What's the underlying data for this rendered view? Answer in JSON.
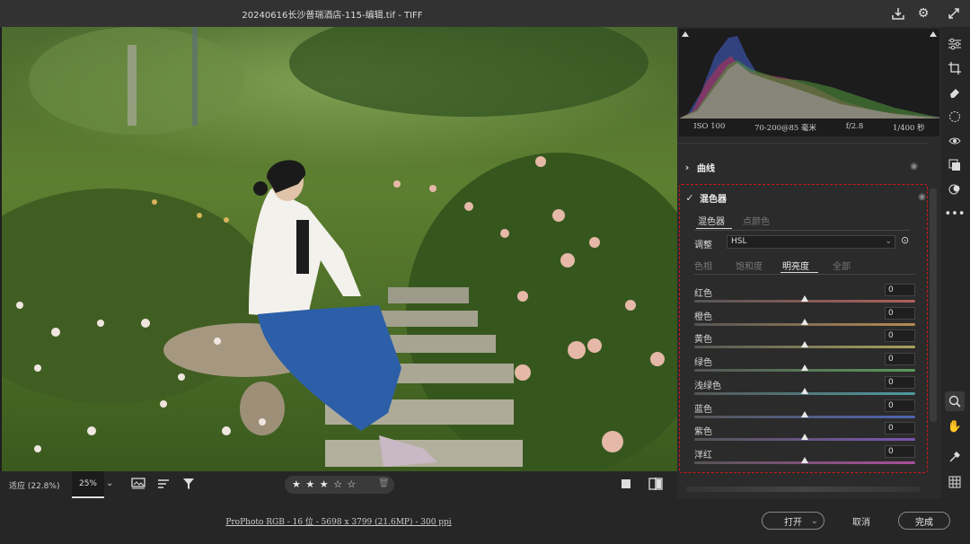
{
  "window": {
    "title": "20240616长沙普瑞酒店-115-编辑.tif -  TIFF"
  },
  "histogram": {
    "iso": "ISO 100",
    "lens": "70-200@85 毫米",
    "aperture": "f/2.8",
    "shutter": "1/400 秒"
  },
  "panels": {
    "curve_label": "曲线",
    "mixer_label": "混色器"
  },
  "mixer": {
    "tabs": [
      "混色器",
      "点颜色"
    ],
    "adjust_label": "调整",
    "adjust_value": "HSL",
    "subtabs": [
      "色相",
      "饱和度",
      "明亮度",
      "全部"
    ],
    "active_subtab": 2,
    "sliders": [
      {
        "label": "红色",
        "value": "0",
        "track_color": "#b0605a"
      },
      {
        "label": "橙色",
        "value": "0",
        "track_color": "#b58a52"
      },
      {
        "label": "黄色",
        "value": "0",
        "track_color": "#a8a35a"
      },
      {
        "label": "绿色",
        "value": "0",
        "track_color": "#5a9a5a"
      },
      {
        "label": "浅绿色",
        "value": "0",
        "track_color": "#4e9aa0"
      },
      {
        "label": "蓝色",
        "value": "0",
        "track_color": "#4e63b0"
      },
      {
        "label": "紫色",
        "value": "0",
        "track_color": "#7a55b0"
      },
      {
        "label": "洋红",
        "value": "0",
        "track_color": "#aa4e9c"
      }
    ]
  },
  "bottombar": {
    "fit_label": "适应 (22.8%)",
    "zoom_value": "25%",
    "rating": "★ ★ ★ ☆ ☆"
  },
  "statusbar": {
    "info": "ProPhoto RGB - 16 位 - 5698 x 3799 (21.6MP) - 300 ppi",
    "open_label": "打开",
    "cancel_label": "取消",
    "done_label": "完成"
  }
}
